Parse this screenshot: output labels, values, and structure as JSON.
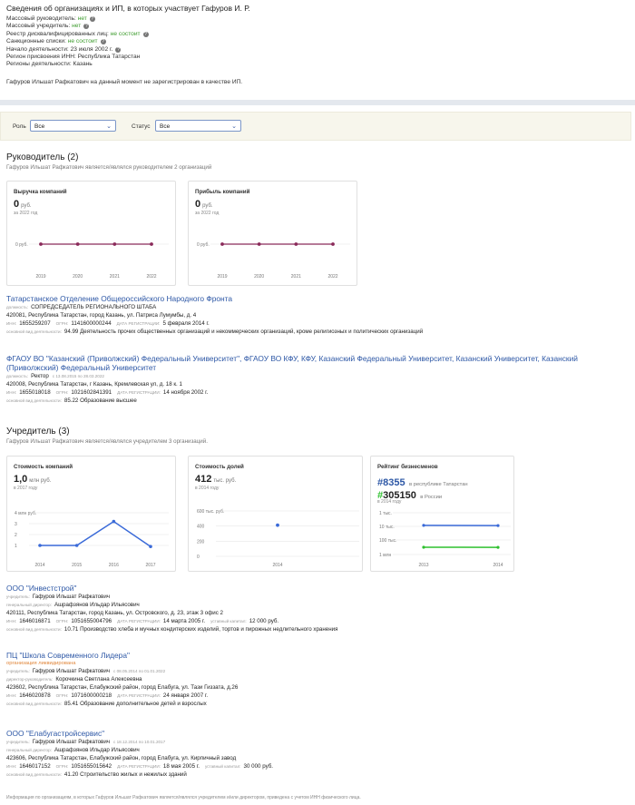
{
  "header": {
    "title": "Сведения об организациях и ИП, в которых участвует Гафуров И. Р.",
    "rows": [
      {
        "label": "Массовый руководитель:",
        "value": "нет",
        "ok": true,
        "help": true
      },
      {
        "label": "Массовый учредитель:",
        "value": "нет",
        "ok": true,
        "help": true
      },
      {
        "label": "Реестр дисквалифицированных лиц:",
        "value": "не состоит",
        "ok": true,
        "help": true
      },
      {
        "label": "Санкционные списки:",
        "value": "не состоит",
        "ok": true,
        "help": true
      },
      {
        "label": "Начало деятельности:",
        "value": "23 июля 2002 г.",
        "ok": false,
        "help": true
      },
      {
        "label": "Регион присвоения ИНН:",
        "value": "Республика Татарстан",
        "ok": false,
        "help": false
      },
      {
        "label": "Регионы деятельности:",
        "value": "Казань",
        "ok": false,
        "help": false
      }
    ],
    "note": "Гафуров Ильшат Рафкатович на данный момент не зарегистрирован в качестве ИП."
  },
  "filter": {
    "role_label": "Роль",
    "role_value": "Все",
    "status_label": "Статус",
    "status_value": "Все"
  },
  "director": {
    "title": "Руководитель (2)",
    "subtitle": "Гафуров Ильшат Рафкатович является/являлся руководителем 2 организаций",
    "revenue": {
      "title": "Выручка компаний",
      "value": "0",
      "unit": "руб.",
      "period": "за 2022 год"
    },
    "profit": {
      "title": "Прибыль компаний",
      "value": "0",
      "unit": "руб.",
      "period": "за 2022 год"
    },
    "orgs": [
      {
        "name": "Татарстанское Отделение Общероссийского Народного Фронта",
        "position_key": "должность:",
        "position": "СОПРЕДСЕДАТЕЛЬ РЕГИОНАЛЬНОГО ШТАБА",
        "address": "420081, Республика Татарстан, город Казань, ул. Патриса Лумумбы, д. 4",
        "inn_key": "ИНН:",
        "inn": "1655259207",
        "ogrn_key": "ОГРН:",
        "ogrn": "1141600000244",
        "reg_key": "ДАТА РЕГИСТРАЦИИ:",
        "reg": "5 февраля 2014 г.",
        "act_key": "основной вид деятельности:",
        "act": "94.99 Деятельность прочих общественных организаций и некоммерческих организаций, кроме религиозных и политических организаций"
      },
      {
        "name": "ФГАОУ ВО \"Казанский (Приволжский) Федеральный Университет\", ФГАОУ ВО КФУ, КФУ, Казанский Федеральный Университет, Казанский Университет, Казанский (Приволжский) Федеральный Университет",
        "position_key": "должность:",
        "position": "Ректор",
        "period": "с 13.08.2015 по 28.03.2022",
        "address": "420008, Республика Татарстан, г Казань, Кремлевская ул, д. 18 к. 1",
        "inn_key": "ИНН:",
        "inn": "1655018018",
        "ogrn_key": "ОГРН:",
        "ogrn": "1021602841391",
        "reg_key": "ДАТА РЕГИСТРАЦИИ:",
        "reg": "14 ноября 2002 г.",
        "act_key": "основной вид деятельности:",
        "act": "85.22 Образование высшее"
      }
    ]
  },
  "founder": {
    "title": "Учредитель (3)",
    "subtitle": "Гафуров Ильшат Рафкатович является/являлся учредителем 3 организаций.",
    "cost": {
      "title": "Стоимость компаний",
      "value": "1,0",
      "unit": "млн руб.",
      "period": "в 2017 году"
    },
    "shares": {
      "title": "Стоимость долей",
      "value": "412",
      "unit": "тыс. руб.",
      "period": "в 2014 году"
    },
    "rating": {
      "title": "Рейтинг бизнесменов",
      "r1": "#8355",
      "r1_text": "в республике Татарстан",
      "r2": "#305150",
      "r2_text": "в России",
      "period": "в 2014 году"
    },
    "orgs": [
      {
        "name": "ООО \"Инвестстрой\"",
        "founder_key": "учредитель:",
        "founder": "Гафуров Ильшат Рафкатович",
        "dir_key": "генеральный директор:",
        "dir": "Ашрафзянов Ильдар Ильясович",
        "address": "420111, Республика Татарстан, город Казань, ул. Островского, д. 23, этаж 3 офис 2",
        "inn_key": "ИНН:",
        "inn": "1646016871",
        "ogrn_key": "ОГРН:",
        "ogrn": "1051655004796",
        "reg_key": "ДАТА РЕГИСТРАЦИИ:",
        "reg": "14 марта 2005 г.",
        "cap_key": "уставный капитал:",
        "cap": "12 000 руб.",
        "act_key": "основной вид деятельности:",
        "act": "10.71 Производство хлеба и мучных кондитерских изделий, тортов и пирожных недлительного хранения"
      },
      {
        "name": "ПЦ \"Школа Современного Лидера\"",
        "status": "организация ликвидирована",
        "founder_key": "учредитель:",
        "founder": "Гафуров Ильшат Рафкатович",
        "founder_period": "с 08.05.2014 по 01.01.2022",
        "dir_key": "директор-руководитель:",
        "dir": "Корочкина Светлана Алексеевна",
        "address": "423602, Республика Татарстан, Елабужский район, город Елабуга, ул. Тази Гиззата, д.26",
        "inn_key": "ИНН:",
        "inn": "1646020878",
        "ogrn_key": "ОГРН:",
        "ogrn": "1071600000218",
        "reg_key": "ДАТА РЕГИСТРАЦИИ:",
        "reg": "24 января 2007 г.",
        "act_key": "основной вид деятельности:",
        "act": "85.41 Образование дополнительное детей и взрослых"
      },
      {
        "name": "ООО \"Елабугастройсервис\"",
        "founder_key": "учредитель:",
        "founder": "Гафуров Ильшат Рафкатович",
        "founder_period": "с 18.12.2014 по 10.01.2017",
        "dir_key": "генеральный директор:",
        "dir": "Ашрафзянов Ильдар Ильясович",
        "address": "423606, Республика Татарстан, Елабужский район, город Елабуга, ул. Кирпичный завод",
        "inn_key": "ИНН:",
        "inn": "1646017152",
        "ogrn_key": "ОГРН:",
        "ogrn": "1051655015642",
        "reg_key": "ДАТА РЕГИСТРАЦИИ:",
        "reg": "18 мая 2005 г.",
        "cap_key": "уставный капитал:",
        "cap": "30 000 руб.",
        "act_key": "основной вид деятельности:",
        "act": "41.20 Строительство жилых и нежилых зданий"
      }
    ]
  },
  "footnote": "Информация по организациям, в которых Гафуров Ильшат Рафкатович является/являлся учредителем и/или директором, приведена с учетом ИНН физического лица.",
  "colors": {
    "link": "#2e58a6",
    "ok": "#3a9a2a",
    "line_purple": "#8a2a5a",
    "line_blue": "#3a6ad8",
    "line_green": "#2ec02e",
    "liquidated": "#e0863a"
  },
  "chart_data": [
    {
      "type": "line",
      "title": "Выручка компаний",
      "x": [
        "2019",
        "2020",
        "2021",
        "2022"
      ],
      "series": [
        {
          "values": [
            0,
            0,
            0,
            0
          ]
        }
      ],
      "ytick": "0 руб."
    },
    {
      "type": "line",
      "title": "Прибыль компаний",
      "x": [
        "2019",
        "2020",
        "2021",
        "2022"
      ],
      "series": [
        {
          "values": [
            0,
            0,
            0,
            0
          ]
        }
      ],
      "ytick": "0 руб."
    },
    {
      "type": "line",
      "title": "Стоимость компаний",
      "x": [
        "2014",
        "2015",
        "2016",
        "2017"
      ],
      "series": [
        {
          "values": [
            1,
            1,
            3.2,
            0.9
          ]
        }
      ],
      "yticks": [
        "4 млн руб.",
        "3",
        "2",
        "1"
      ],
      "ylim": [
        0,
        4
      ]
    },
    {
      "type": "scatter",
      "title": "Стоимость долей",
      "x": [
        "2014"
      ],
      "series": [
        {
          "values": [
            412
          ]
        }
      ],
      "yticks": [
        "600 тыс. руб.",
        "400",
        "200",
        "0"
      ],
      "ylim": [
        0,
        600
      ]
    },
    {
      "type": "line",
      "title": "Рейтинг бизнесменов",
      "x": [
        "2013",
        "2014"
      ],
      "series": [
        {
          "values": [
            8000,
            8355
          ]
        },
        {
          "values": [
            300000,
            305150
          ]
        }
      ],
      "yticks": [
        "1 тыс.",
        "10 тыс.",
        "100 тыс.",
        "1 млн"
      ]
    }
  ]
}
